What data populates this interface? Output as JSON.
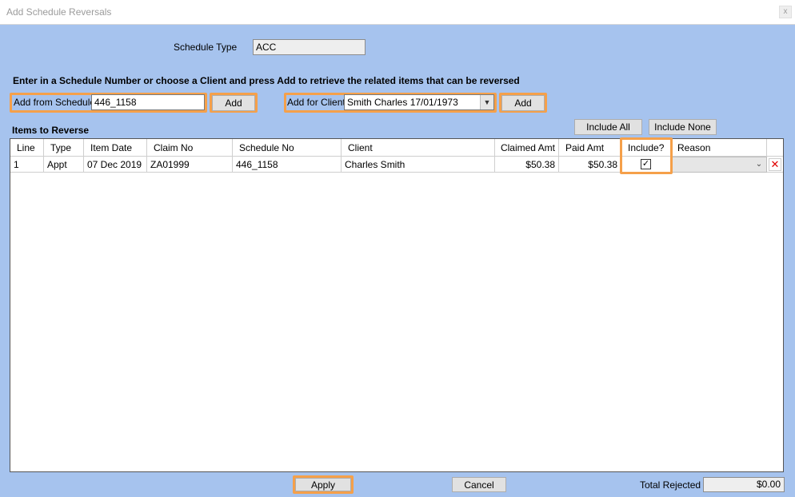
{
  "window": {
    "title": "Add Schedule Reversals",
    "close_label": "x"
  },
  "schedule_type": {
    "label": "Schedule Type",
    "value": "ACC"
  },
  "instruction": "Enter in a Schedule Number or choose a Client and press Add to retrieve the related items that can be reversed",
  "add_from_schedule": {
    "label": "Add from Schedule",
    "value": "446_1158",
    "button": "Add"
  },
  "add_for_client": {
    "label": "Add for Client",
    "value": "Smith Charles 17/01/1973",
    "button": "Add"
  },
  "items_section": {
    "label": "Items to Reverse",
    "include_all": "Include All",
    "include_none": "Include None"
  },
  "table": {
    "columns": [
      "Line",
      "Type",
      "Item Date",
      "Claim No",
      "Schedule No",
      "Client",
      "Claimed Amt",
      "Paid Amt",
      "Include?",
      "Reason"
    ],
    "rows": [
      {
        "line": "1",
        "type": "Appt",
        "item_date": "07 Dec 2019",
        "claim_no": "ZA01999",
        "schedule_no": "446_1158",
        "client": "Charles Smith",
        "claimed_amt": "$50.38",
        "paid_amt": "$50.38",
        "include": true,
        "reason": ""
      }
    ]
  },
  "footer": {
    "apply": "Apply",
    "cancel": "Cancel",
    "total_rejected_label": "Total Rejected",
    "total_rejected_value": "$0.00"
  },
  "colors": {
    "background": "#a6c3ee",
    "highlight": "#f5a04a",
    "delete_icon": "#e00000"
  }
}
